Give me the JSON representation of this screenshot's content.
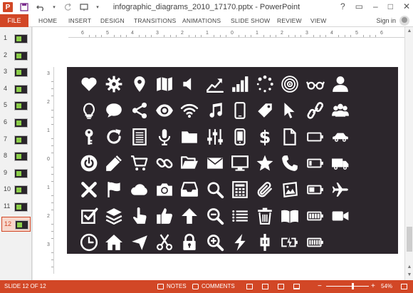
{
  "window": {
    "title": "infographic_diagrams_2010_17170.pptx - PowerPoint",
    "app_logo": "P",
    "help_glyph": "?",
    "restore_glyph": "▭",
    "minimize_glyph": "–",
    "maximize_glyph": "□",
    "close_glyph": "✕"
  },
  "ribbon": {
    "file_label": "FILE",
    "tabs": [
      "HOME",
      "INSERT",
      "DESIGN",
      "TRANSITIONS",
      "ANIMATIONS",
      "SLIDE SHOW",
      "REVIEW",
      "VIEW"
    ],
    "sign_in": "Sign in"
  },
  "thumbnails": {
    "numbers": [
      "1",
      "2",
      "3",
      "4",
      "5",
      "6",
      "7",
      "8",
      "9",
      "10",
      "11",
      "12"
    ],
    "active": "12"
  },
  "rulers": {
    "h_labels": [
      "6",
      "5",
      "4",
      "3",
      "2",
      "1",
      "0",
      "1",
      "2",
      "3",
      "4",
      "5",
      "6"
    ],
    "v_labels": [
      "3",
      "2",
      "1",
      "0",
      "1",
      "2",
      "3"
    ]
  },
  "slide": {
    "background": "#2c262c",
    "icon_color": "#ffffff",
    "icons": [
      [
        "heart",
        "gear",
        "map-pin",
        "map",
        "speaker",
        "trend-up",
        "bar-chart",
        "spinner",
        "target",
        "glasses",
        "user"
      ],
      [
        "bulb",
        "chat",
        "share",
        "eye",
        "wifi",
        "music",
        "phone",
        "tag",
        "cursor",
        "link-chain",
        "users"
      ],
      [
        "key",
        "refresh",
        "document-lines",
        "microphone",
        "folder",
        "sliders",
        "smartphone",
        "dollar",
        "file",
        "battery-empty",
        "car"
      ],
      [
        "power",
        "pencil",
        "cart",
        "link",
        "folder-open",
        "envelope",
        "monitor",
        "star",
        "telephone",
        "battery-low",
        "truck"
      ],
      [
        "close-x",
        "flag",
        "cloud",
        "camera",
        "inbox",
        "search",
        "calculator",
        "paperclip",
        "picture",
        "battery-half",
        "airplane"
      ],
      [
        "checkbox",
        "layers",
        "hand-pointer",
        "thumbs-up",
        "arrow-up",
        "zoom-out",
        "list",
        "trash",
        "book",
        "battery-full",
        "video-camera"
      ],
      [
        "clock",
        "home",
        "send",
        "scissors",
        "lock",
        "zoom-in",
        "lightning",
        "dollar-sign-alt",
        "battery-charging",
        "battery-max"
      ]
    ]
  },
  "status": {
    "slide_info": "SLIDE 12 OF 12",
    "notes": "NOTES",
    "comments": "COMMENTS",
    "zoom": "54%",
    "zoom_minus": "−",
    "zoom_plus": "+"
  }
}
